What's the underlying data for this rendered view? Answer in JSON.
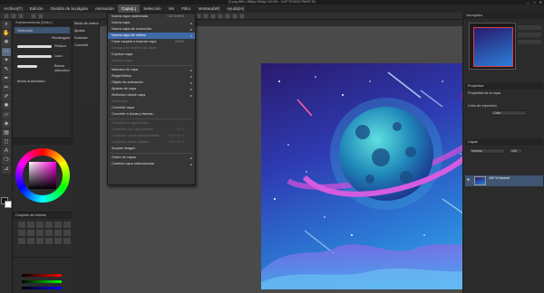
{
  "window": {
    "title": "(*) png 866 x 866px 300dpi 100.0% - CLIP STUDIO PAINT EX",
    "buttons": [
      "—",
      "□",
      "✕"
    ]
  },
  "menubar": {
    "items": [
      "Archivo(F)",
      "Edición",
      "Gestión de la página",
      "Animación",
      "Capa(L)",
      "Selección",
      "Ver",
      "Filtro",
      "Ventana(W)",
      "Ayuda(H)"
    ],
    "active_index": 4
  },
  "subtool_panel": {
    "tabs": [
      "Subherramienta [Selec.]"
    ],
    "items": [
      "Selección",
      "Rectángulo"
    ],
    "brushes": [
      "Pintura",
      "Lazo",
      "Borrar selección"
    ],
    "extra": "Modo automático"
  },
  "tool_props": {
    "rows": [
      "Modo de selección",
      "Ajustar",
      "Suavizar",
      "Convertir"
    ]
  },
  "color_set": {
    "header": "Conjunto de colores"
  },
  "right_panel": {
    "tabs": [
      "Navegador",
      "Propiedad",
      "Capas"
    ],
    "layer_props_title": "Propiedad de la capa",
    "blend_mode": "Normal",
    "layer_color": "Color de expresión",
    "layer_color_value": "Color",
    "opacity": "100",
    "layer_name": "100 % Normal",
    "layer_sublabel": "Papel"
  },
  "capa_menu": {
    "items": [
      {
        "label": "Nueva capa rasterizada",
        "shortcut": "Ctrl+Shift+N",
        "disabled": false,
        "submenu": false
      },
      {
        "label": "Nueva capa",
        "shortcut": "",
        "disabled": false,
        "submenu": true
      },
      {
        "label": "Nueva capa de corrección",
        "shortcut": "",
        "disabled": false,
        "submenu": true
      },
      {
        "label": "Nueva capa de relleno",
        "shortcut": "",
        "disabled": false,
        "submenu": true,
        "highlight": true
      },
      {
        "label": "Crear carpeta e insertar capa",
        "shortcut": "Ctrl+G",
        "disabled": false,
        "submenu": false
      },
      {
        "label": "Desagrupar carpeta de capas",
        "shortcut": "",
        "disabled": true,
        "submenu": false
      },
      {
        "label": "Duplicar capa",
        "shortcut": "",
        "disabled": false,
        "submenu": false
      },
      {
        "label": "Eliminar capa",
        "shortcut": "",
        "disabled": true,
        "submenu": false
      },
      {
        "sep": true
      },
      {
        "label": "Máscara de capa",
        "shortcut": "",
        "disabled": false,
        "submenu": true
      },
      {
        "label": "Regla/Viñeta",
        "shortcut": "",
        "disabled": false,
        "submenu": true
      },
      {
        "label": "Objeto de animación",
        "shortcut": "",
        "disabled": false,
        "submenu": true
      },
      {
        "label": "Ajustes de capa",
        "shortcut": "",
        "disabled": false,
        "submenu": true
      },
      {
        "label": "Selección desde capa",
        "shortcut": "",
        "disabled": false,
        "submenu": true
      },
      {
        "label": "Rasterizar",
        "shortcut": "",
        "disabled": true,
        "submenu": false
      },
      {
        "label": "Convertir capa",
        "shortcut": "",
        "disabled": false,
        "submenu": false
      },
      {
        "label": "Convertir a líneas y tramas...",
        "shortcut": "",
        "disabled": false,
        "submenu": false
      },
      {
        "sep": true
      },
      {
        "label": "Transferir a capa inferior",
        "shortcut": "",
        "disabled": true,
        "submenu": false
      },
      {
        "label": "Combinar con capa inferior",
        "shortcut": "Ctrl+E",
        "disabled": true,
        "submenu": false
      },
      {
        "label": "Combinar capas seleccionadas",
        "shortcut": "Shift+Alt+E",
        "disabled": true,
        "submenu": false
      },
      {
        "label": "Combinar capas visibles",
        "shortcut": "Shift+Alt+E",
        "disabled": true,
        "submenu": false
      },
      {
        "label": "Acoplar imagen",
        "shortcut": "",
        "disabled": false,
        "submenu": false
      },
      {
        "sep": true
      },
      {
        "label": "Orden de capas",
        "shortcut": "",
        "disabled": false,
        "submenu": true
      },
      {
        "label": "Cambiar capa seleccionada",
        "shortcut": "",
        "disabled": false,
        "submenu": true
      }
    ]
  },
  "colors": {
    "accent": "#3f6aa8",
    "menu_bg": "#363636",
    "app_bg": "#2a2a2a"
  }
}
